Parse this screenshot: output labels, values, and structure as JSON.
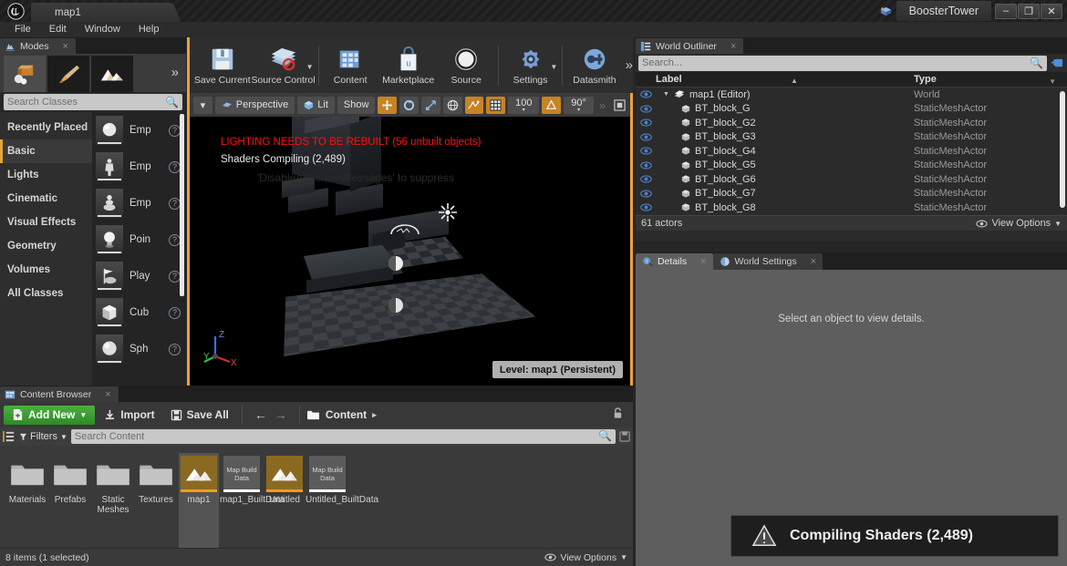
{
  "titlebar": {
    "logo": "ue-logo",
    "map_tab": "map1",
    "project_name": "BoosterTower",
    "minimize": "–",
    "maximize": "❐",
    "close": "✕"
  },
  "menubar": {
    "items": [
      "File",
      "Edit",
      "Window",
      "Help"
    ]
  },
  "modes_panel": {
    "tab_label": "Modes",
    "tab_close": "×",
    "mode_buttons": [
      "place-mode-icon",
      "paint-mode-icon",
      "landscape-mode-icon"
    ],
    "more_modes": "»",
    "search": {
      "placeholder": "Search Classes",
      "value": ""
    },
    "categories": [
      {
        "label": "Recently Placed",
        "active": false
      },
      {
        "label": "Basic",
        "active": true
      },
      {
        "label": "Lights",
        "active": false
      },
      {
        "label": "Cinematic",
        "active": false
      },
      {
        "label": "Visual Effects",
        "active": false
      },
      {
        "label": "Geometry",
        "active": false
      },
      {
        "label": "Volumes",
        "active": false
      },
      {
        "label": "All Classes",
        "active": false
      }
    ],
    "placeables": [
      {
        "label": "Emp",
        "icon": "sphere-actor-icon"
      },
      {
        "label": "Emp",
        "icon": "character-actor-icon"
      },
      {
        "label": "Emp",
        "icon": "pawn-actor-icon"
      },
      {
        "label": "Poin",
        "icon": "point-light-icon"
      },
      {
        "label": "Play",
        "icon": "player-start-icon"
      },
      {
        "label": "Cub",
        "icon": "cube-icon"
      },
      {
        "label": "Sph",
        "icon": "sphere-icon"
      }
    ],
    "help_glyph": "?"
  },
  "toolbar": {
    "items": [
      {
        "label": "Save Current",
        "icon": "save-icon",
        "has_caret": false
      },
      {
        "label": "Source Control",
        "icon": "source-control-icon",
        "has_caret": true
      },
      {
        "label": "Content",
        "icon": "content-icon",
        "has_caret": false
      },
      {
        "label": "Marketplace",
        "icon": "marketplace-icon",
        "has_caret": false
      },
      {
        "label": "Source",
        "icon": "source-icon",
        "has_caret": false
      },
      {
        "label": "Settings",
        "icon": "settings-icon",
        "has_caret": true
      },
      {
        "label": "Datasmith",
        "icon": "datasmith-icon",
        "has_caret": false
      }
    ],
    "overflow": "»"
  },
  "viewport": {
    "toolbar": {
      "menu_caret": "▾",
      "perspective": "Perspective",
      "lit": "Lit",
      "show": "Show",
      "translate_icon": "translate-gizmo-icon",
      "rotate_icon": "rotate-gizmo-icon",
      "scale_icon": "scale-gizmo-icon",
      "world_icon": "world-coordinate-icon",
      "surface_snap_icon": "surface-snap-icon",
      "grid_snap_icon": "grid-snap-icon",
      "grid_size": "100",
      "angle_snap_icon": "angle-snap-icon",
      "angle_size": "90°",
      "overflow": "»",
      "maximize_icon": "maximize-viewport-icon"
    },
    "warning": "LIGHTING NEEDS TO BE REBUILT (56 unbuilt objects)",
    "status": "Shaders Compiling (2,489)",
    "ghost_hint": "'DisableAllScreenMessages' to suppress",
    "level_badge": "Level:  map1 (Persistent)",
    "axis": {
      "x": "X",
      "y": "Y",
      "z": "Z"
    }
  },
  "outliner": {
    "tab_label": "World Outliner",
    "tab_close": "×",
    "search": {
      "placeholder": "Search...",
      "value": ""
    },
    "add_icon": "add-actor-icon",
    "columns": [
      "Label",
      "Type"
    ],
    "rows": [
      {
        "label": "map1 (Editor)",
        "type": "World",
        "level": 0,
        "icon": "world-icon"
      },
      {
        "label": "BT_block_G",
        "type": "StaticMeshActor",
        "level": 1,
        "icon": "static-mesh-icon"
      },
      {
        "label": "BT_block_G2",
        "type": "StaticMeshActor",
        "level": 1,
        "icon": "static-mesh-icon"
      },
      {
        "label": "BT_block_G3",
        "type": "StaticMeshActor",
        "level": 1,
        "icon": "static-mesh-icon"
      },
      {
        "label": "BT_block_G4",
        "type": "StaticMeshActor",
        "level": 1,
        "icon": "static-mesh-icon"
      },
      {
        "label": "BT_block_G5",
        "type": "StaticMeshActor",
        "level": 1,
        "icon": "static-mesh-icon"
      },
      {
        "label": "BT_block_G6",
        "type": "StaticMeshActor",
        "level": 1,
        "icon": "static-mesh-icon"
      },
      {
        "label": "BT_block_G7",
        "type": "StaticMeshActor",
        "level": 1,
        "icon": "static-mesh-icon"
      },
      {
        "label": "BT_block_G8",
        "type": "StaticMeshActor",
        "level": 1,
        "icon": "static-mesh-icon"
      }
    ],
    "footer_count": "61 actors",
    "view_options": "View Options"
  },
  "details": {
    "tabs": [
      {
        "label": "Details",
        "active": true,
        "icon": "details-icon"
      },
      {
        "label": "World Settings",
        "active": false,
        "icon": "world-settings-icon"
      }
    ],
    "tab_close": "×",
    "empty_text": "Select an object to view details."
  },
  "content_browser": {
    "tab_label": "Content Browser",
    "tab_close": "×",
    "add_new": "Add New",
    "add_new_caret": "▾",
    "import": "Import",
    "save_all": "Save All",
    "nav_back": "←",
    "nav_forward": "→",
    "breadcrumb": "Content",
    "breadcrumb_caret": "▸",
    "lock_icon": "lock-icon",
    "filters": "Filters",
    "filters_caret": "▾",
    "search": {
      "placeholder": "Search Content",
      "value": ""
    },
    "save_search_icon": "save-search-icon",
    "assets": [
      {
        "name": "Materials",
        "kind": "folder",
        "selected": false
      },
      {
        "name": "Prefabs",
        "kind": "folder",
        "selected": false
      },
      {
        "name": "Static Meshes",
        "kind": "folder",
        "selected": false
      },
      {
        "name": "Textures",
        "kind": "folder",
        "selected": false
      },
      {
        "name": "map1",
        "kind": "map",
        "selected": true
      },
      {
        "name": "map1_BuiltData",
        "kind": "builtdata",
        "thumb_text": "Map Build Data",
        "selected": false
      },
      {
        "name": "Untitled",
        "kind": "map",
        "selected": false
      },
      {
        "name": "Untitled_BuiltData",
        "kind": "builtdata",
        "thumb_text": "Map Build Data",
        "selected": false
      }
    ],
    "footer_status": "8 items (1 selected)",
    "view_options": "View Options"
  },
  "notification": {
    "icon": "warning-triangle-icon",
    "text": "Compiling Shaders (2,489)"
  },
  "colors": {
    "accent_orange": "#e8a33d",
    "toggle_on": "#c88324",
    "green_button": "#4caf3f",
    "warning_red": "#ff1010",
    "panel_dark": "#2b2b2b",
    "details_grey": "#5e5e5e"
  }
}
